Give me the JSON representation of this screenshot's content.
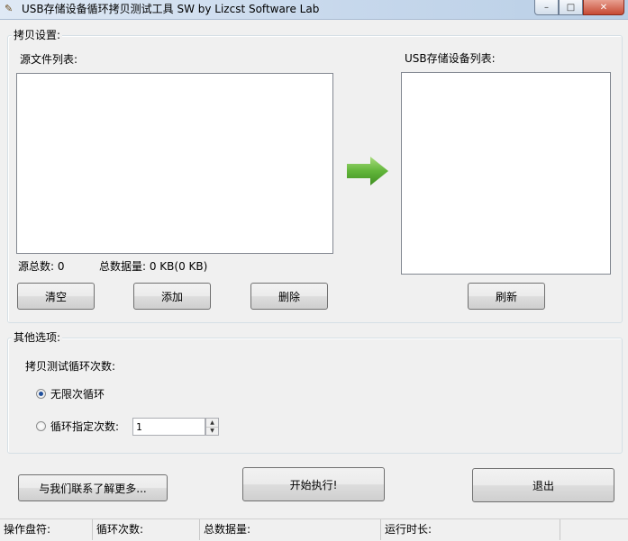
{
  "window": {
    "title": "USB存储设备循环拷贝测试工具 SW  by Lizcst Software Lab",
    "controls": {
      "minimize": "–",
      "maximize": "□",
      "close": "✕"
    }
  },
  "copy_settings": {
    "group_title": "拷贝设置:",
    "source_list_label": "源文件列表:",
    "usb_list_label": "USB存储设备列表:",
    "source_count": "源总数: 0",
    "total_data": "总数据量: 0 KB(0 KB)",
    "buttons": {
      "clear": "清空",
      "add": "添加",
      "delete": "删除",
      "refresh": "刷新"
    }
  },
  "other_options": {
    "group_title": "其他选项:",
    "loop_label": "拷贝测试循环次数:",
    "radio_infinite": "无限次循环",
    "radio_specified": "循环指定次数:",
    "loop_count_value": "1"
  },
  "actions": {
    "contact": "与我们联系了解更多...",
    "start": "开始执行!",
    "exit": "退出"
  },
  "statusbar": {
    "drive": "操作盘符:",
    "loops": "循环次数:",
    "total": "总数据量:",
    "runtime": "运行时长:"
  },
  "colors": {
    "arrow_green": "#62b53a",
    "accent_blue": "#1f4f9c"
  }
}
